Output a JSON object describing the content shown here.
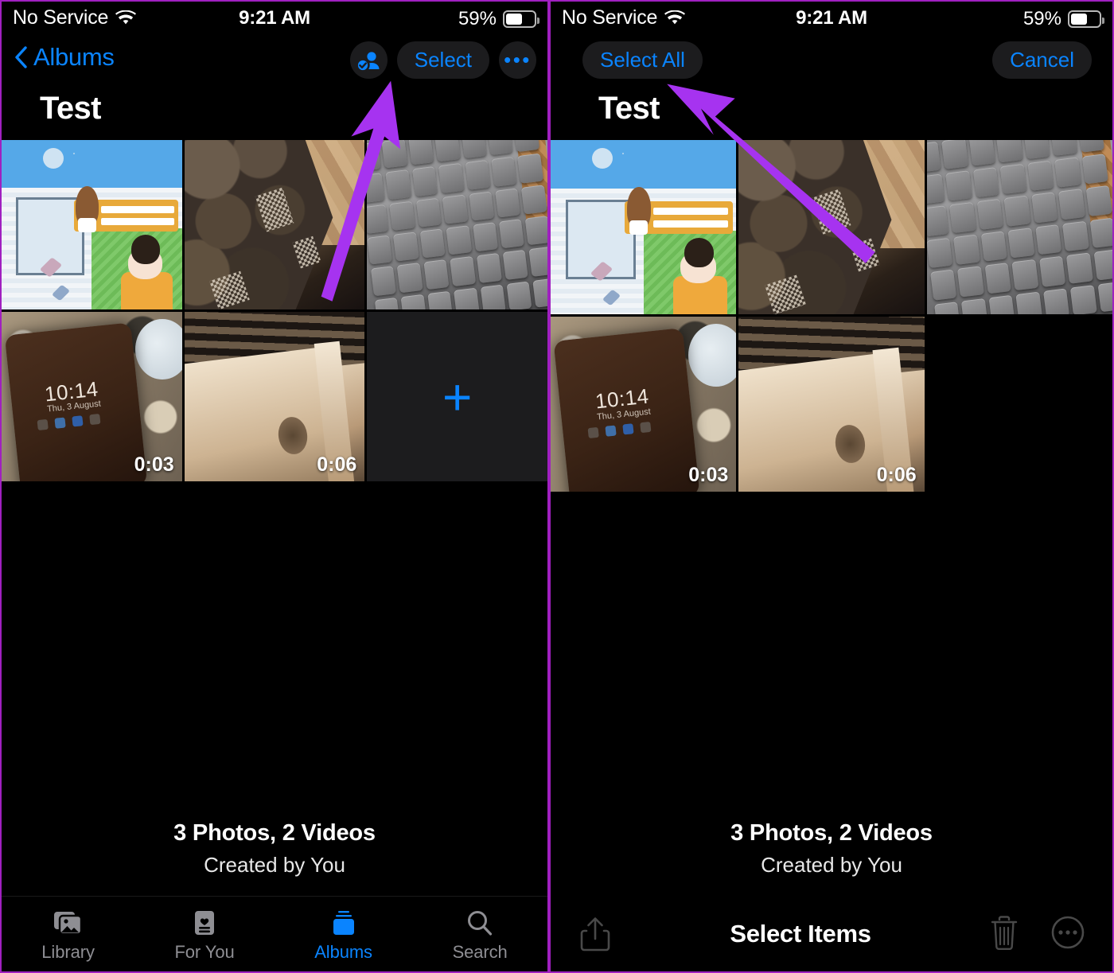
{
  "panels": [
    {
      "id": "browse",
      "statusbar": {
        "carrier": "No Service",
        "time": "9:21 AM",
        "battery": "59%",
        "wifi_icon": "wifi-icon",
        "battery_icon": "battery-icon"
      },
      "nav": {
        "back_label": "Albums",
        "back_icon": "chevron-left-icon",
        "shared_icon": "shared-album-person-icon",
        "select_label": "Select",
        "more_icon": "ellipsis-icon"
      },
      "title": "Test",
      "grid": [
        {
          "name": "game-screenshot",
          "type": "photo",
          "duration": ""
        },
        {
          "name": "tiled-floor-photo",
          "type": "photo",
          "duration": ""
        },
        {
          "name": "laptop-keyboard-photo",
          "type": "photo",
          "duration": ""
        },
        {
          "name": "phone-on-counter-video",
          "type": "video",
          "duration": "0:03"
        },
        {
          "name": "radiator-video",
          "type": "video",
          "duration": "0:06"
        },
        {
          "name": "add-photos-tile",
          "type": "add",
          "duration": "",
          "plus": "+"
        }
      ],
      "meta": {
        "counts": "3 Photos, 2 Videos",
        "creator": "Created by You"
      },
      "tabs": [
        {
          "label": "Library",
          "icon": "library-photos-icon",
          "active": false
        },
        {
          "label": "For You",
          "icon": "for-you-card-icon",
          "active": false
        },
        {
          "label": "Albums",
          "icon": "albums-stack-icon",
          "active": true
        },
        {
          "label": "Search",
          "icon": "search-magnifier-icon",
          "active": false
        }
      ],
      "annotation": {
        "color": "#a633f0",
        "points_to": "Select"
      }
    },
    {
      "id": "selection",
      "statusbar": {
        "carrier": "No Service",
        "time": "9:21 AM",
        "battery": "59%",
        "wifi_icon": "wifi-icon",
        "battery_icon": "battery-icon"
      },
      "nav": {
        "select_all_label": "Select All",
        "cancel_label": "Cancel"
      },
      "title": "Test",
      "grid": [
        {
          "name": "game-screenshot",
          "type": "photo",
          "duration": ""
        },
        {
          "name": "tiled-floor-photo",
          "type": "photo",
          "duration": ""
        },
        {
          "name": "laptop-keyboard-photo",
          "type": "photo",
          "duration": ""
        },
        {
          "name": "phone-on-counter-video",
          "type": "video",
          "duration": "0:03"
        },
        {
          "name": "radiator-video",
          "type": "video",
          "duration": "0:06"
        },
        {
          "name": "empty-slot",
          "type": "empty",
          "duration": ""
        }
      ],
      "meta": {
        "counts": "3 Photos, 2 Videos",
        "creator": "Created by You"
      },
      "toolbar": {
        "share_icon": "share-upload-icon",
        "title": "Select Items",
        "trash_icon": "trash-icon",
        "more_icon": "ellipsis-circle-icon"
      },
      "annotation": {
        "color": "#a633f0",
        "points_to": "Select All"
      }
    }
  ],
  "colors": {
    "accent_blue": "#0a84ff",
    "annotation_purple": "#a633f0",
    "panel_border": "#a020c0",
    "background": "#000000",
    "button_bg": "#1c1c1e",
    "inactive_tab": "#8e8e93"
  }
}
